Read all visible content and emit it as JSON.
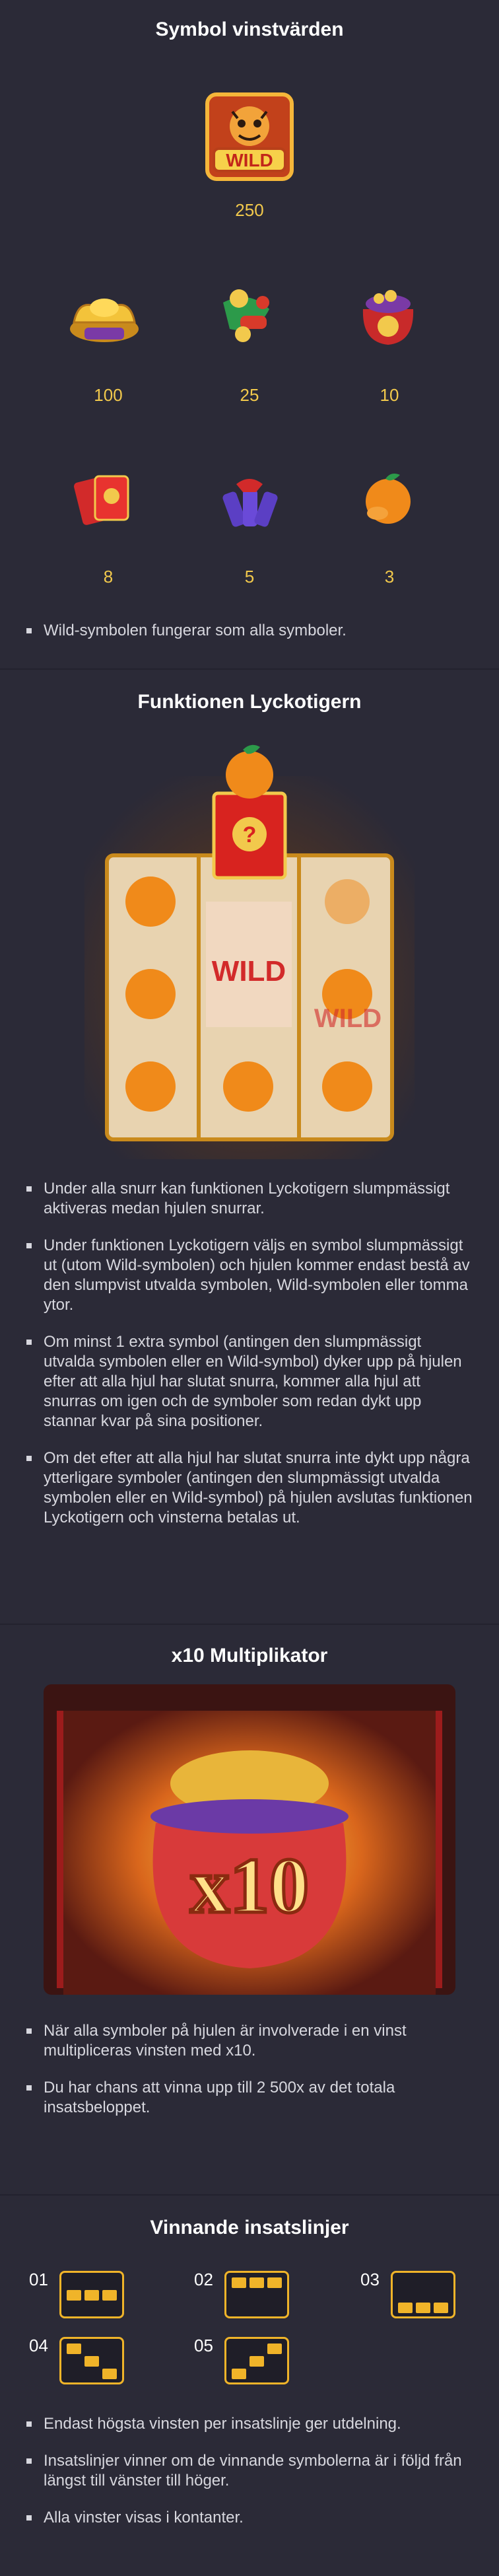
{
  "symbols_section": {
    "title": "Symbol vinstvärden",
    "wild_value": "250",
    "row1": [
      {
        "icon": "gold-ingot-icon",
        "value": "100"
      },
      {
        "icon": "firecrackers-icon",
        "value": "25"
      },
      {
        "icon": "lucky-bag-icon",
        "value": "10"
      }
    ],
    "row2": [
      {
        "icon": "red-envelope-icon",
        "value": "8"
      },
      {
        "icon": "firecracker-bundle-icon",
        "value": "5"
      },
      {
        "icon": "orange-icon",
        "value": "3"
      }
    ],
    "note": "Wild-symbolen fungerar som alla symboler."
  },
  "feature_section": {
    "title": "Funktionen Lyckotigern",
    "bullets": [
      "Under alla snurr kan funktionen Lyckotigern slumpmässigt aktiveras medan hjulen snurrar.",
      "Under funktionen Lyckotigern väljs en symbol slumpmässigt ut (utom Wild-symbolen) och hjulen kommer endast bestå av den slumpvist utvalda symbolen, Wild-symbolen eller tomma ytor.",
      "Om minst 1 extra symbol (antingen den slumpmässigt utvalda symbolen eller en Wild-symbol) dyker upp på hjulen efter att alla hjul har slutat snurra, kommer alla hjul att snurras om igen och de symboler som redan dykt upp stannar kvar på sina positioner.",
      "Om det efter att alla hjul har slutat snurra inte dykt upp några ytterligare symboler (antingen den slumpmässigt utvalda symbolen eller en Wild-symbol) på hjulen avslutas funktionen Lyckotigern och vinsterna betalas ut."
    ]
  },
  "multiplier_section": {
    "title": "x10 Multiplikator",
    "art_text": "x10",
    "bullets": [
      "När alla symboler på hjulen är involverade i en vinst multipliceras vinsten med x10.",
      "Du har chans att vinna upp till 2 500x av det totala insatsbeloppet."
    ]
  },
  "paylines_section": {
    "title": "Vinnande insatslinjer",
    "lines": [
      {
        "num": "01",
        "rows": [
          1,
          1,
          1
        ]
      },
      {
        "num": "02",
        "rows": [
          0,
          0,
          0
        ]
      },
      {
        "num": "03",
        "rows": [
          2,
          2,
          2
        ]
      },
      {
        "num": "04",
        "rows": [
          0,
          1,
          2
        ]
      },
      {
        "num": "05",
        "rows": [
          2,
          1,
          0
        ]
      }
    ],
    "bullets": [
      "Endast högsta vinsten per insatslinje ger utdelning.",
      "Insatslinjer vinner om de vinnande symbolerna är i följd från längst till vänster till höger.",
      "Alla vinster visas i kontanter."
    ]
  },
  "colors": {
    "background": "#2b2a37",
    "accent_gold": "#f2c94c",
    "payline": "#f0b429"
  }
}
